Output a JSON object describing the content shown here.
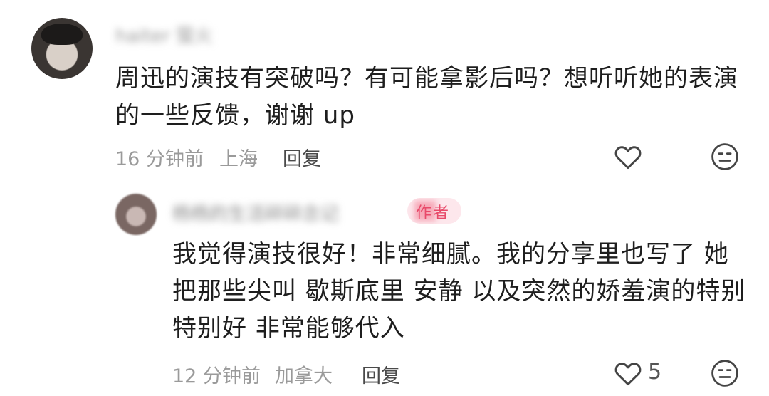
{
  "comment": {
    "username": "haiter 萤火",
    "text_line1": "周迅的演技有突破吗？有可能拿影后吗？想听听她的表演",
    "text_line2": "的一些反馈，谢谢 up",
    "time": "16 分钟前",
    "location": "上海",
    "reply_label": "回复",
    "like_icon": "heart-outline-icon",
    "reaction_icon": "meh-face-icon"
  },
  "reply": {
    "username": "杨杨的生活碎碎念记",
    "badge": "作者",
    "text_line1": "我觉得演技很好！非常细腻。我的分享里也写了 她",
    "text_line2": "把那些尖叫 歇斯底里 安静 以及突然的娇羞演的特别",
    "text_line3": "特别好 非常能够代入",
    "time": "12 分钟前",
    "location": "加拿大",
    "reply_label": "回复",
    "like_count": "5",
    "like_icon": "heart-outline-icon",
    "reaction_icon": "meh-face-icon"
  }
}
